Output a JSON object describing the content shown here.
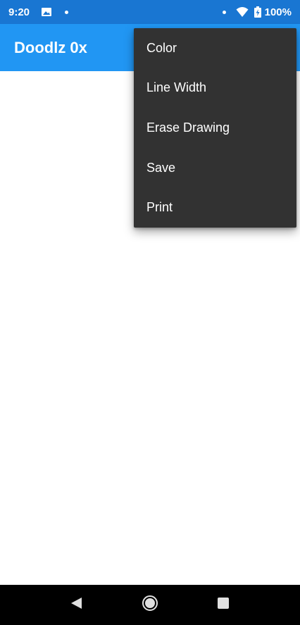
{
  "status_bar": {
    "time": "9:20",
    "battery_percent": "100%",
    "icons": [
      "image-icon",
      "notification-dot-icon",
      "notification-dot-icon",
      "wifi-icon",
      "battery-charging-icon"
    ]
  },
  "app_bar": {
    "title": "Doodlz 0x",
    "background_color": "#2196F3"
  },
  "overflow_menu": {
    "items": [
      {
        "label": "Color"
      },
      {
        "label": "Line Width"
      },
      {
        "label": "Erase Drawing"
      },
      {
        "label": "Save"
      },
      {
        "label": "Print"
      }
    ],
    "background_color": "#323232"
  },
  "nav_bar": {
    "icons": [
      "back-icon",
      "home-icon",
      "recents-icon"
    ]
  }
}
